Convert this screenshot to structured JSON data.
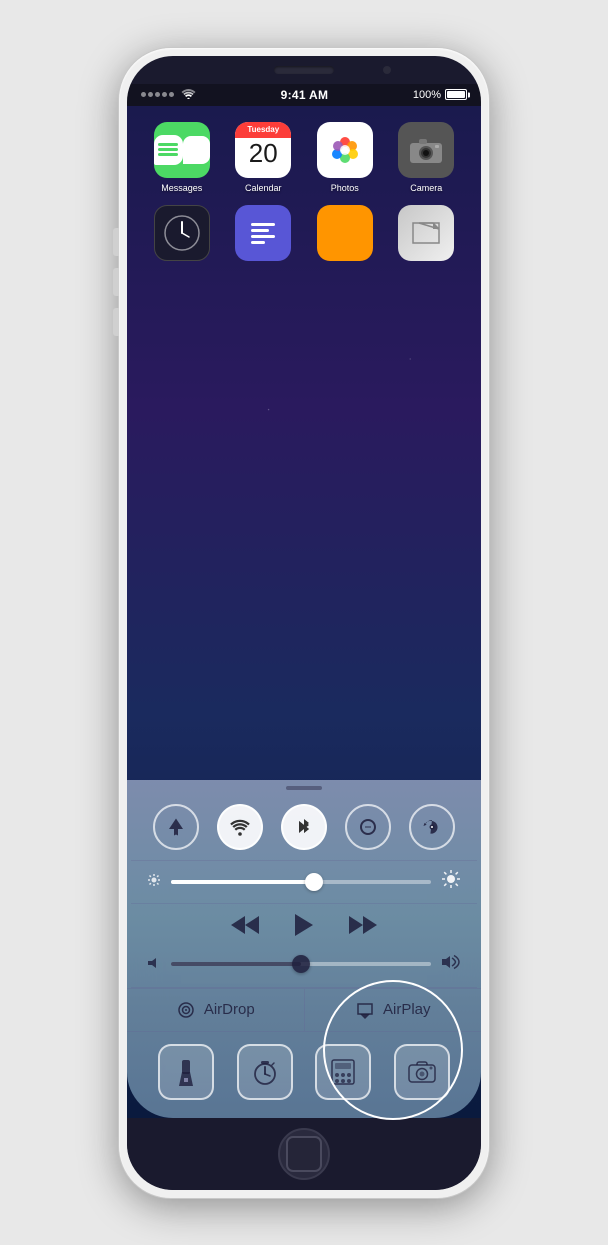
{
  "phone": {
    "status_bar": {
      "time": "9:41 AM",
      "battery": "100%"
    },
    "home_screen": {
      "apps_row1": [
        {
          "name": "Messages",
          "label": "Messages"
        },
        {
          "name": "Calendar",
          "label": "Calendar",
          "day": "Tuesday",
          "date": "20"
        },
        {
          "name": "Photos",
          "label": "Photos"
        },
        {
          "name": "Camera",
          "label": "Camera"
        }
      ]
    },
    "control_center": {
      "toggles": [
        {
          "id": "airplane",
          "label": "Airplane Mode",
          "active": false
        },
        {
          "id": "wifi",
          "label": "Wi-Fi",
          "active": true
        },
        {
          "id": "bluetooth",
          "label": "Bluetooth",
          "active": true
        },
        {
          "id": "donotdisturb",
          "label": "Do Not Disturb",
          "active": false
        },
        {
          "id": "rotation",
          "label": "Rotation Lock",
          "active": false
        }
      ],
      "brightness_pct": 55,
      "volume_pct": 50,
      "airdrop_label": "AirDrop",
      "airplay_label": "AirPlay",
      "tools": [
        {
          "id": "flashlight",
          "label": "Flashlight"
        },
        {
          "id": "timer",
          "label": "Timer"
        },
        {
          "id": "calculator",
          "label": "Calculator"
        },
        {
          "id": "camera",
          "label": "Camera"
        }
      ]
    }
  }
}
